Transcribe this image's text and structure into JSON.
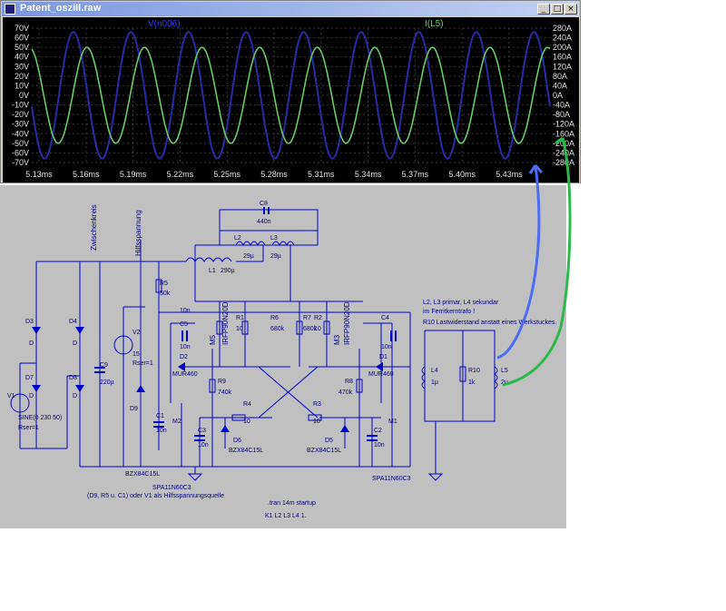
{
  "window": {
    "title": "Patent_oszill.raw"
  },
  "plot": {
    "trace_v_label": "V(n006)",
    "trace_i_label": "I(L5)",
    "colors": {
      "v": "#2a2aa8",
      "i": "#66cc66",
      "grid": "#3a3a3a",
      "text": "#e0e0e0",
      "vlabel": "#3a3aff"
    },
    "y_left_ticks": [
      "70V",
      "60V",
      "50V",
      "40V",
      "30V",
      "20V",
      "10V",
      "0V",
      "-10V",
      "-20V",
      "-30V",
      "-40V",
      "-50V",
      "-60V",
      "-70V"
    ],
    "y_right_ticks": [
      "280A",
      "240A",
      "200A",
      "160A",
      "120A",
      "80A",
      "40A",
      "0A",
      "-40A",
      "-80A",
      "-120A",
      "-160A",
      "-200A",
      "-240A",
      "-280A"
    ],
    "x_ticks": [
      "5.13ms",
      "5.16ms",
      "5.19ms",
      "5.22ms",
      "5.25ms",
      "5.28ms",
      "5.31ms",
      "5.34ms",
      "5.37ms",
      "5.40ms",
      "5.43ms"
    ]
  },
  "chart_data": {
    "type": "line",
    "x_range_ms": [
      5.13,
      5.445
    ],
    "ylim_left_V": [
      -70,
      70
    ],
    "ylim_right_A": [
      -280,
      280
    ],
    "grid": true,
    "series": [
      {
        "name": "V(n006)",
        "axis": "left",
        "unit": "V",
        "amplitude": 66,
        "cycles": 9,
        "phase_deg": 190
      },
      {
        "name": "I(L5)",
        "axis": "right",
        "unit": "A",
        "amplitude": 200,
        "cycles": 9,
        "phase_deg": 105
      }
    ]
  },
  "schematic": {
    "labels": {
      "zwischenkreis": "Zwischenkreis",
      "hilfsspannung": "Hilfsspannung",
      "c8": "C8",
      "c8v": "440n",
      "l2": "L2",
      "l2v": "29µ",
      "l3": "L3",
      "l3v": "29µ",
      "l1": "L1",
      "l1v": "290µ",
      "r5": "R5",
      "r5v": "50k",
      "c10n": "10n",
      "r1": "R1",
      "r1v": "10",
      "r6": "R6",
      "r6v": "680k",
      "r7": "R7",
      "r7v": "680k",
      "r2": "R2",
      "r2v": "10",
      "m5": "M5",
      "m5v": "IRFP90N20D",
      "m3": "M3",
      "m3v": "IRFP90N20D",
      "c5": "C5",
      "c5v": "10n",
      "c4": "C4",
      "c4v": "10n",
      "d2": "D2",
      "d2v": "MUR460",
      "d1": "D1",
      "d1v": "MUR460",
      "r9": "R9",
      "r9v": "740k",
      "r8": "R8",
      "r8v": "470k",
      "r4": "R4",
      "r4v": "10",
      "r3": "R3",
      "r3v": "10",
      "m2": "M2",
      "m1": "M1",
      "c1": "C1",
      "c1v": "10n",
      "c3": "C3",
      "c3v": "10n",
      "c2": "C2",
      "c2v": "10n",
      "d6": "D6",
      "d6v": "BZX84C15L",
      "d5": "D5",
      "d5v": "BZX84C15L",
      "d3": "D3",
      "d3v": "D",
      "d4": "D4",
      "d4v": "D",
      "d7": "D7",
      "d7v": "D",
      "d8": "D8",
      "d8v": "D",
      "c9": "C9",
      "c9v": "220µ",
      "v2": "V2",
      "v2v": "15",
      "v2r": "Rser=1",
      "d9": "D9",
      "d9v": "BZX84C15L",
      "v1": "V1",
      "v1v": "SINE(0 230 50)",
      "v1r": "Rser=1",
      "spa_left": "SPA11N60C3",
      "spa_right": "SPA11N60C3",
      "note_bottom": "(D9, R5 u. C1) oder V1 als Hilfsspannungsquelle",
      "tran": ".tran 14m startup",
      "coupling": "K1 L2 L3  L4 1.",
      "note_r1": "L2, L3 primar, L4 sekundar",
      "note_r2": "im Ferritkerntrafo !",
      "note_r3": "R10 Lastwiderstand anstatt eines Werkstuckes.",
      "l4": "L4",
      "l4v": "1µ",
      "r10": "R10",
      "r10v": "1k",
      "l5": "L5",
      "l5v": "2µ"
    }
  }
}
